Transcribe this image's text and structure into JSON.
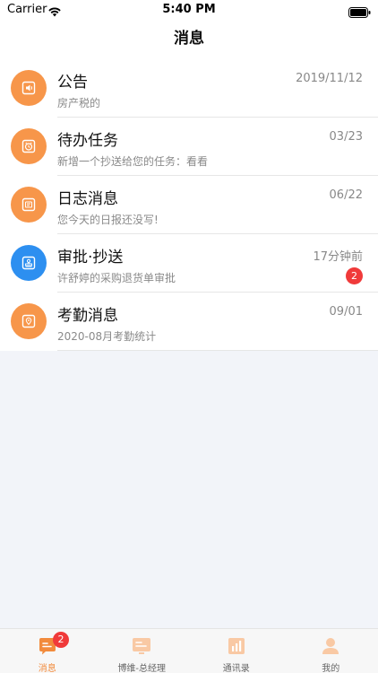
{
  "status_bar": {
    "carrier": "Carrier",
    "time": "5:40 PM"
  },
  "nav": {
    "title": "消息"
  },
  "messages": [
    {
      "title": "公告",
      "date": "2019/11/12",
      "subtitle": "房产税的",
      "icon": "speaker-icon",
      "color": "#f7964a"
    },
    {
      "title": "待办任务",
      "date": "03/23",
      "subtitle": "新增一个抄送给您的任务：看看",
      "icon": "alarm-clock-icon",
      "color": "#f7964a"
    },
    {
      "title": "日志消息",
      "date": "06/22",
      "subtitle": "您今天的日报还没写!",
      "icon": "notebook-icon",
      "color": "#f7964a"
    },
    {
      "title": "审批·抄送",
      "date": "17分钟前",
      "subtitle": "许舒婷的采购退货单审批",
      "icon": "stamp-icon",
      "color": "#2d8ff0",
      "badge": "2"
    },
    {
      "title": "考勤消息",
      "date": "09/01",
      "subtitle": "2020-08月考勤统计",
      "icon": "location-card-icon",
      "color": "#f7964a"
    }
  ],
  "tabbar": {
    "tabs": [
      {
        "label": "消息",
        "badge": "2",
        "icon": "chat-bubble-icon",
        "active": true
      },
      {
        "label": "博维-总经理",
        "icon": "workbench-icon"
      },
      {
        "label": "通讯录",
        "icon": "contacts-chart-icon"
      },
      {
        "label": "我的",
        "icon": "person-icon"
      }
    ],
    "active_color": "#f28b3c"
  }
}
